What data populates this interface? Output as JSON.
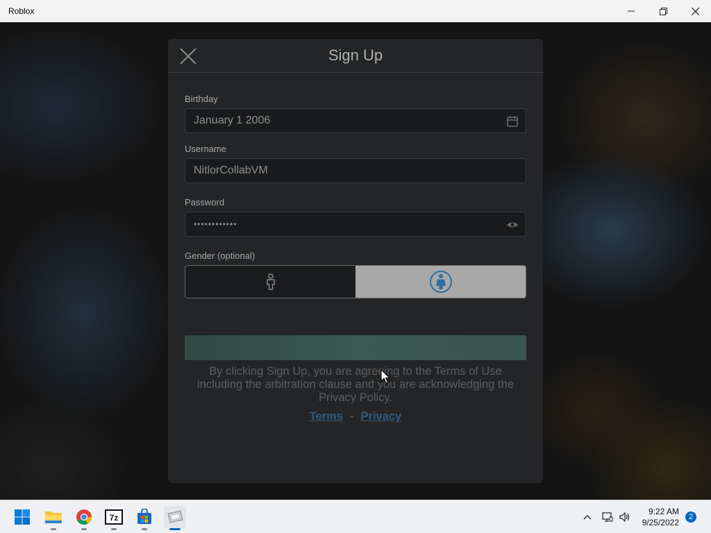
{
  "window": {
    "title": "Roblox"
  },
  "modal": {
    "title": "Sign Up",
    "birthday": {
      "label": "Birthday",
      "value": "January 1 2006"
    },
    "username": {
      "label": "Username",
      "value": "NitlorCollabVM"
    },
    "password": {
      "label": "Password",
      "value": "••••••••••••"
    },
    "gender": {
      "label": "Gender (optional)",
      "selected": "female"
    },
    "legal_text": "By clicking Sign Up, you are agreeing to the Terms of Use including the arbitration clause and you are acknowledging the Privacy Policy.",
    "terms_link": "Terms",
    "separator": "-",
    "privacy_link": "Privacy"
  },
  "taskbar": {
    "icons": [
      "start-icon",
      "file-explorer-icon",
      "chrome-icon",
      "7zip-icon",
      "store-icon",
      "roblox-icon"
    ],
    "active": "roblox-icon",
    "clock_time": "9:22 AM",
    "clock_date": "9/25/2022",
    "notification_count": "2"
  },
  "colors": {
    "accent": "#0067c0",
    "modal_bg": "#232527",
    "link": "#335a7a"
  }
}
